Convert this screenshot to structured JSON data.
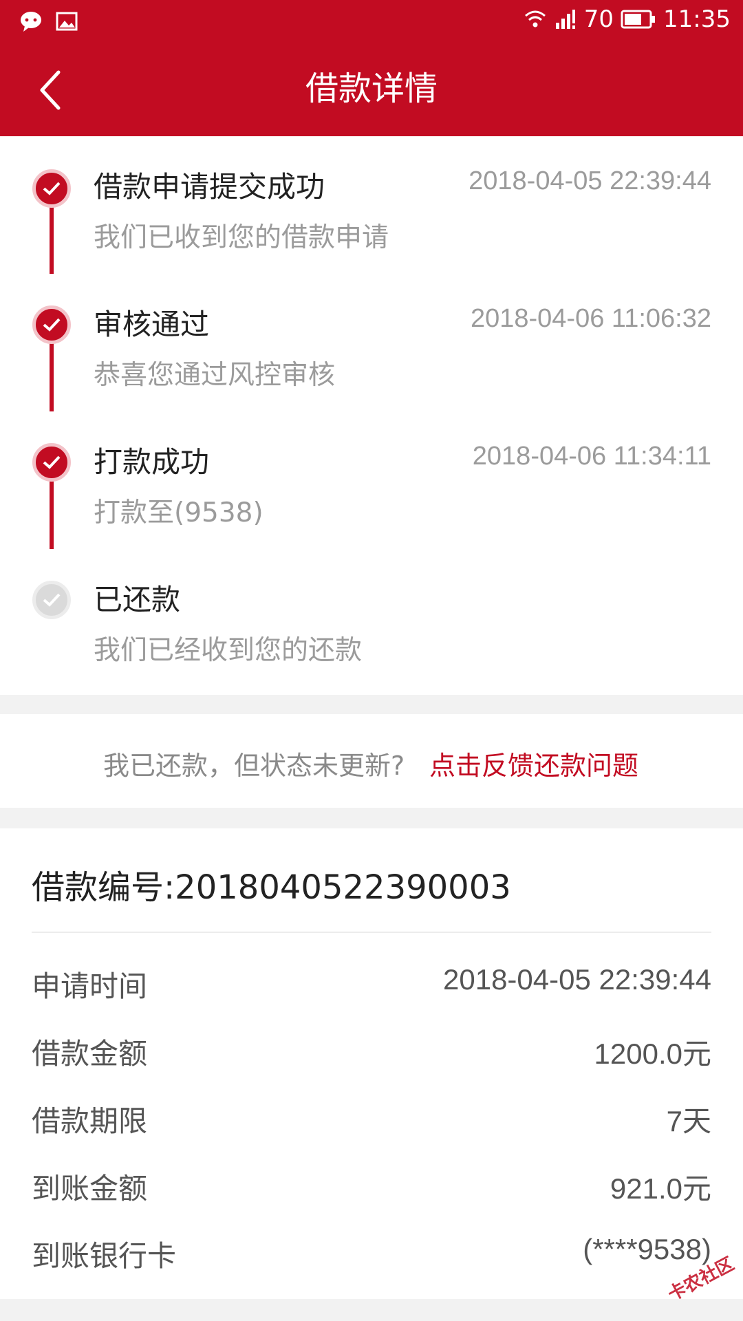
{
  "status_bar": {
    "signal_text": "70",
    "time": "11:35"
  },
  "nav": {
    "title": "借款详情"
  },
  "timeline": [
    {
      "title": "借款申请提交成功",
      "time": "2018-04-05 22:39:44",
      "desc": "我们已收到您的借款申请",
      "done": true
    },
    {
      "title": "审核通过",
      "time": "2018-04-06 11:06:32",
      "desc": "恭喜您通过风控审核",
      "done": true
    },
    {
      "title": "打款成功",
      "time": "2018-04-06 11:34:11",
      "desc": "打款至(9538)",
      "done": true
    },
    {
      "title": "已还款",
      "time": "",
      "desc": "我们已经收到您的还款",
      "done": false
    }
  ],
  "feedback": {
    "question": "我已还款，但状态未更新?",
    "link": "点击反馈还款问题"
  },
  "details": {
    "loan_number": "借款编号:2018040522390003",
    "rows": [
      {
        "label": "申请时间",
        "value": "2018-04-05 22:39:44"
      },
      {
        "label": "借款金额",
        "value": "1200.0元"
      },
      {
        "label": "借款期限",
        "value": "7天"
      },
      {
        "label": "到账金额",
        "value": "921.0元"
      },
      {
        "label": "到账银行卡",
        "value": "(****9538)"
      }
    ]
  },
  "watermark": "卡农社区",
  "colors": {
    "brand_red": "#c20c22",
    "muted_gray": "#9b9b9b"
  }
}
